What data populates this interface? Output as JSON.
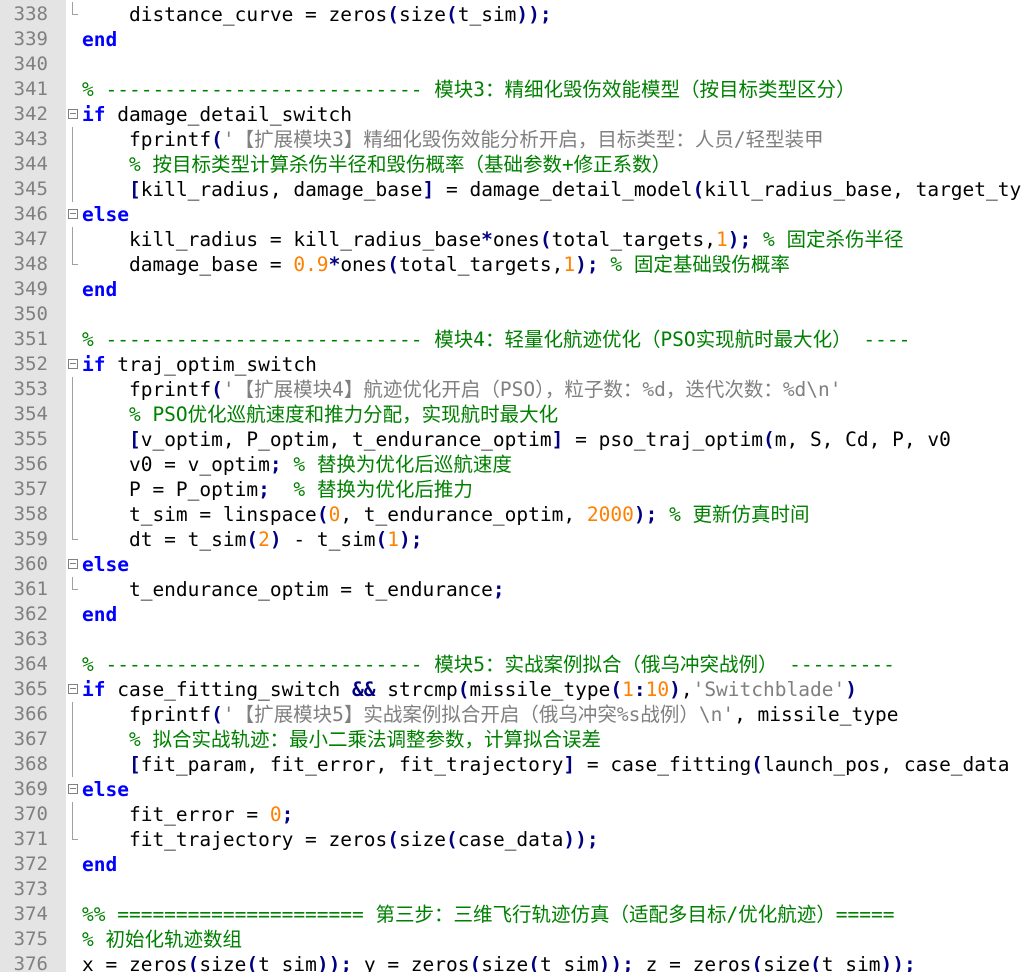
{
  "editor": {
    "lines": [
      {
        "n": "338",
        "fold": "end",
        "t": [
          [
            "    distance_curve = zeros",
            "d"
          ],
          [
            "(",
            "o"
          ],
          [
            "size",
            "d"
          ],
          [
            "(",
            "o"
          ],
          [
            "t_sim",
            "d"
          ],
          [
            ")",
            "o"
          ],
          [
            ")",
            "o"
          ],
          [
            ";",
            "o"
          ]
        ]
      },
      {
        "n": "339",
        "fold": "",
        "t": [
          [
            "end",
            "k"
          ]
        ]
      },
      {
        "n": "340",
        "fold": "",
        "t": []
      },
      {
        "n": "341",
        "fold": "",
        "t": [
          [
            "% --------------------------- 模块3：精细化毁伤效能模型（按目标类型区分）",
            "c"
          ]
        ]
      },
      {
        "n": "342",
        "fold": "box",
        "t": [
          [
            "if",
            "k"
          ],
          [
            " damage_detail_switch",
            "d"
          ]
        ]
      },
      {
        "n": "343",
        "fold": "bar",
        "t": [
          [
            "    fprintf",
            "d"
          ],
          [
            "(",
            "o"
          ],
          [
            "'【扩展模块3】精细化毁伤效能分析开启，目标类型：人员/轻型装甲",
            "s"
          ]
        ]
      },
      {
        "n": "344",
        "fold": "bar",
        "t": [
          [
            "    % 按目标类型计算杀伤半径和毁伤概率（基础参数+修正系数）",
            "c"
          ]
        ]
      },
      {
        "n": "345",
        "fold": "bar",
        "t": [
          [
            "    ",
            "d"
          ],
          [
            "[",
            "o"
          ],
          [
            "kill_radius, damage_base",
            "d"
          ],
          [
            "]",
            "o"
          ],
          [
            " = damage_detail_model",
            "d"
          ],
          [
            "(",
            "o"
          ],
          [
            "kill_radius_base, target_type",
            "d"
          ]
        ]
      },
      {
        "n": "346",
        "fold": "box",
        "t": [
          [
            "else",
            "k"
          ]
        ]
      },
      {
        "n": "347",
        "fold": "bar",
        "t": [
          [
            "    kill_radius = kill_radius_base",
            "d"
          ],
          [
            "*",
            "o"
          ],
          [
            "ones",
            "d"
          ],
          [
            "(",
            "o"
          ],
          [
            "total_targets,",
            "d"
          ],
          [
            "1",
            "n"
          ],
          [
            ")",
            "o"
          ],
          [
            ";",
            "o"
          ],
          [
            " ",
            "d"
          ],
          [
            "% 固定杀伤半径",
            "c"
          ]
        ]
      },
      {
        "n": "348",
        "fold": "end",
        "t": [
          [
            "    damage_base = ",
            "d"
          ],
          [
            "0.9",
            "n"
          ],
          [
            "*",
            "o"
          ],
          [
            "ones",
            "d"
          ],
          [
            "(",
            "o"
          ],
          [
            "total_targets,",
            "d"
          ],
          [
            "1",
            "n"
          ],
          [
            ")",
            "o"
          ],
          [
            ";",
            "o"
          ],
          [
            " ",
            "d"
          ],
          [
            "% 固定基础毁伤概率",
            "c"
          ]
        ]
      },
      {
        "n": "349",
        "fold": "",
        "t": [
          [
            "end",
            "k"
          ]
        ]
      },
      {
        "n": "350",
        "fold": "",
        "t": []
      },
      {
        "n": "351",
        "fold": "",
        "t": [
          [
            "% --------------------------- 模块4：轻量化航迹优化（PSO实现航时最大化） ----",
            "c"
          ]
        ]
      },
      {
        "n": "352",
        "fold": "box",
        "t": [
          [
            "if",
            "k"
          ],
          [
            " traj_optim_switch",
            "d"
          ]
        ]
      },
      {
        "n": "353",
        "fold": "bar",
        "t": [
          [
            "    fprintf",
            "d"
          ],
          [
            "(",
            "o"
          ],
          [
            "'【扩展模块4】航迹优化开启（PSO），粒子数：%d，迭代次数：%d\\n'",
            "s"
          ]
        ]
      },
      {
        "n": "354",
        "fold": "bar",
        "t": [
          [
            "    % PSO优化巡航速度和推力分配，实现航时最大化",
            "c"
          ]
        ]
      },
      {
        "n": "355",
        "fold": "bar",
        "t": [
          [
            "    ",
            "d"
          ],
          [
            "[",
            "o"
          ],
          [
            "v_optim, P_optim, t_endurance_optim",
            "d"
          ],
          [
            "]",
            "o"
          ],
          [
            " = pso_traj_optim",
            "d"
          ],
          [
            "(",
            "o"
          ],
          [
            "m, S, Cd, P, v0",
            "d"
          ]
        ]
      },
      {
        "n": "356",
        "fold": "bar",
        "t": [
          [
            "    v0 = v_optim",
            "d"
          ],
          [
            ";",
            "o"
          ],
          [
            " ",
            "d"
          ],
          [
            "% 替换为优化后巡航速度",
            "c"
          ]
        ]
      },
      {
        "n": "357",
        "fold": "bar",
        "t": [
          [
            "    P = P_optim",
            "d"
          ],
          [
            ";",
            "o"
          ],
          [
            "  ",
            "d"
          ],
          [
            "% 替换为优化后推力",
            "c"
          ]
        ]
      },
      {
        "n": "358",
        "fold": "bar",
        "t": [
          [
            "    t_sim = linspace",
            "d"
          ],
          [
            "(",
            "o"
          ],
          [
            "0",
            "n"
          ],
          [
            ", t_endurance_optim, ",
            "d"
          ],
          [
            "2000",
            "n"
          ],
          [
            ")",
            "o"
          ],
          [
            ";",
            "o"
          ],
          [
            " ",
            "d"
          ],
          [
            "% 更新仿真时间",
            "c"
          ]
        ]
      },
      {
        "n": "359",
        "fold": "end",
        "t": [
          [
            "    dt = t_sim",
            "d"
          ],
          [
            "(",
            "o"
          ],
          [
            "2",
            "n"
          ],
          [
            ")",
            "o"
          ],
          [
            " - t_sim",
            "d"
          ],
          [
            "(",
            "o"
          ],
          [
            "1",
            "n"
          ],
          [
            ")",
            "o"
          ],
          [
            ";",
            "o"
          ]
        ]
      },
      {
        "n": "360",
        "fold": "box",
        "t": [
          [
            "else",
            "k"
          ]
        ]
      },
      {
        "n": "361",
        "fold": "end",
        "t": [
          [
            "    t_endurance_optim = t_endurance",
            "d"
          ],
          [
            ";",
            "o"
          ]
        ]
      },
      {
        "n": "362",
        "fold": "",
        "t": [
          [
            "end",
            "k"
          ]
        ]
      },
      {
        "n": "363",
        "fold": "",
        "t": []
      },
      {
        "n": "364",
        "fold": "",
        "t": [
          [
            "% --------------------------- 模块5：实战案例拟合（俄乌冲突战例） ---------",
            "c"
          ]
        ]
      },
      {
        "n": "365",
        "fold": "box",
        "t": [
          [
            "if",
            "k"
          ],
          [
            " case_fitting_switch ",
            "d"
          ],
          [
            "&&",
            "o"
          ],
          [
            " strcmp",
            "d"
          ],
          [
            "(",
            "o"
          ],
          [
            "missile_type",
            "d"
          ],
          [
            "(",
            "o"
          ],
          [
            "1",
            "n"
          ],
          [
            ":",
            "o"
          ],
          [
            "10",
            "n"
          ],
          [
            ")",
            "o"
          ],
          [
            ",",
            "d"
          ],
          [
            "'Switchblade'",
            "s"
          ],
          [
            ")",
            "o"
          ]
        ]
      },
      {
        "n": "366",
        "fold": "bar",
        "t": [
          [
            "    fprintf",
            "d"
          ],
          [
            "(",
            "o"
          ],
          [
            "'【扩展模块5】实战案例拟合开启（俄乌冲突%s战例）\\n'",
            "s"
          ],
          [
            ", missile_type",
            "d"
          ]
        ]
      },
      {
        "n": "367",
        "fold": "bar",
        "t": [
          [
            "    % 拟合实战轨迹：最小二乘法调整参数，计算拟合误差",
            "c"
          ]
        ]
      },
      {
        "n": "368",
        "fold": "bar",
        "t": [
          [
            "    ",
            "d"
          ],
          [
            "[",
            "o"
          ],
          [
            "fit_param, fit_error, fit_trajectory",
            "d"
          ],
          [
            "]",
            "o"
          ],
          [
            " = case_fitting",
            "d"
          ],
          [
            "(",
            "o"
          ],
          [
            "launch_pos, case_data",
            "d"
          ]
        ]
      },
      {
        "n": "369",
        "fold": "box",
        "t": [
          [
            "else",
            "k"
          ]
        ]
      },
      {
        "n": "370",
        "fold": "bar",
        "t": [
          [
            "    fit_error = ",
            "d"
          ],
          [
            "0",
            "n"
          ],
          [
            ";",
            "o"
          ]
        ]
      },
      {
        "n": "371",
        "fold": "end",
        "t": [
          [
            "    fit_trajectory = zeros",
            "d"
          ],
          [
            "(",
            "o"
          ],
          [
            "size",
            "d"
          ],
          [
            "(",
            "o"
          ],
          [
            "case_data",
            "d"
          ],
          [
            ")",
            "o"
          ],
          [
            ")",
            "o"
          ],
          [
            ";",
            "o"
          ]
        ]
      },
      {
        "n": "372",
        "fold": "",
        "t": [
          [
            "end",
            "k"
          ]
        ]
      },
      {
        "n": "373",
        "fold": "",
        "t": []
      },
      {
        "n": "374",
        "fold": "",
        "t": [
          [
            "%% ===================== 第三步：三维飞行轨迹仿真（适配多目标/优化航迹）=====",
            "c"
          ]
        ]
      },
      {
        "n": "375",
        "fold": "",
        "t": [
          [
            "% 初始化轨迹数组",
            "c"
          ]
        ]
      },
      {
        "n": "376",
        "fold": "",
        "t": [
          [
            "x = zeros",
            "d"
          ],
          [
            "(",
            "o"
          ],
          [
            "size",
            "d"
          ],
          [
            "(",
            "o"
          ],
          [
            "t_sim",
            "d"
          ],
          [
            ")",
            "o"
          ],
          [
            ")",
            "o"
          ],
          [
            ";",
            "o"
          ],
          [
            " y = zeros",
            "d"
          ],
          [
            "(",
            "o"
          ],
          [
            "size",
            "d"
          ],
          [
            "(",
            "o"
          ],
          [
            "t_sim",
            "d"
          ],
          [
            ")",
            "o"
          ],
          [
            ")",
            "o"
          ],
          [
            ";",
            "o"
          ],
          [
            " z = zeros",
            "d"
          ],
          [
            "(",
            "o"
          ],
          [
            "size",
            "d"
          ],
          [
            "(",
            "o"
          ],
          [
            "t_sim",
            "d"
          ],
          [
            ")",
            "o"
          ],
          [
            ")",
            "o"
          ],
          [
            ";",
            "o"
          ]
        ]
      }
    ]
  },
  "colors": {
    "keyword": "#0000ff",
    "comment": "#008000",
    "string": "#808080",
    "number": "#ff8000",
    "operator": "#000080",
    "gutter_bg": "#e4e4e4",
    "line_number": "#808080"
  },
  "icons": {
    "fold_open": "fold-minus-icon",
    "fold_line": "fold-line-icon",
    "fold_end": "fold-end-icon"
  }
}
